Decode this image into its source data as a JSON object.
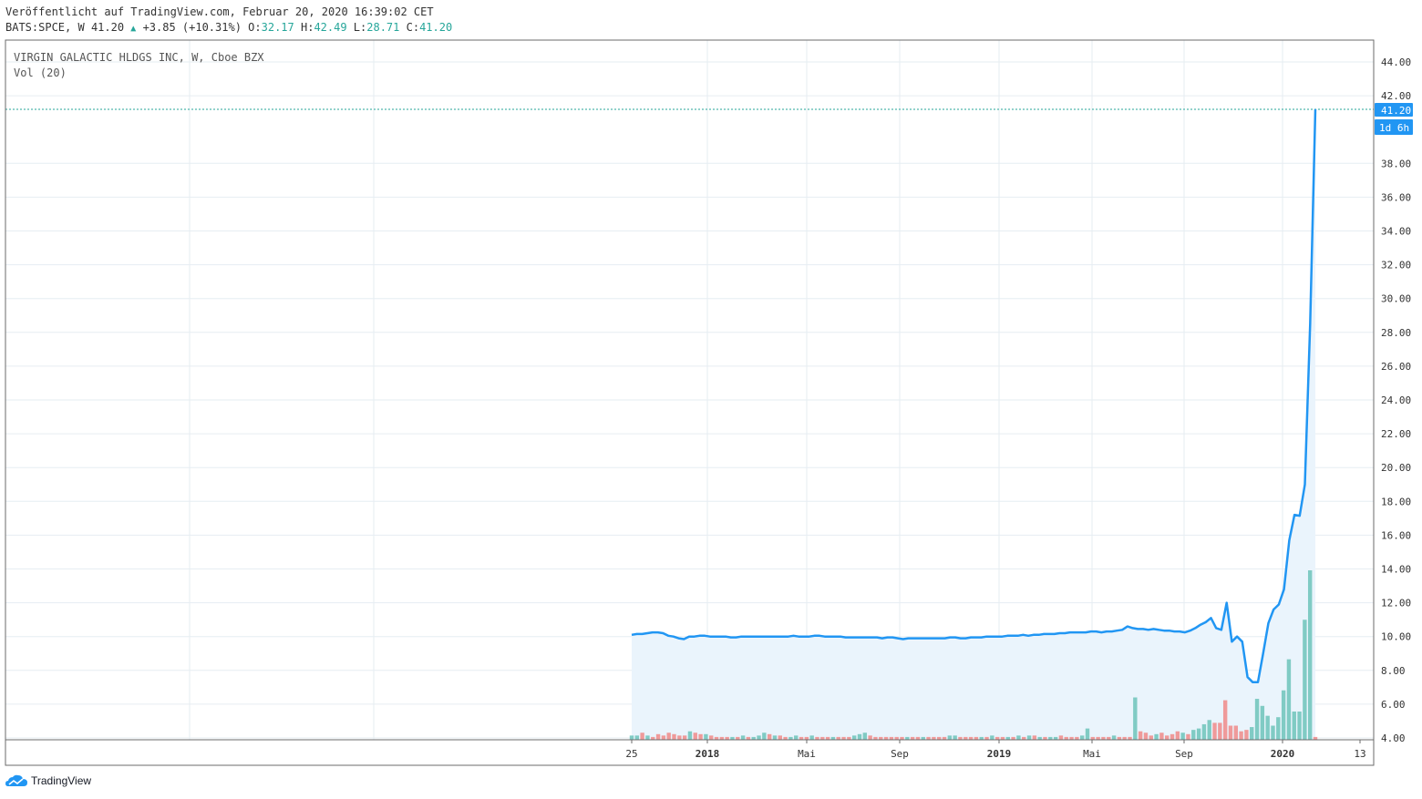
{
  "header": {
    "published": "Veröffentlicht auf TradingView.com, Februar 20, 2020 16:39:02 CET",
    "symbol": "BATS:SPCE, W",
    "last": "41.20",
    "change": "+3.85 (+10.31%)",
    "open_label": "O:",
    "open": "32.17",
    "high_label": "H:",
    "high": "42.49",
    "low_label": "L:",
    "low": "28.71",
    "close_label": "C:",
    "close": "41.20"
  },
  "legend": {
    "title": "VIRGIN GALACTIC HLDGS INC, W, Cboe BZX",
    "volume": "Vol (20)"
  },
  "price_badge": "41.20",
  "countdown_badge": "1d 6h",
  "brand": "TradingView",
  "colors": {
    "line": "#2196f3",
    "area": "#eaf4fc",
    "vol_up": "#80cbc4",
    "vol_down": "#ef9a9a",
    "grid": "#e6edf2",
    "price_line": "#26a69a"
  },
  "chart_data": {
    "type": "line",
    "ylim": [
      4,
      45
    ],
    "y_ticks": [
      "44.00",
      "42.00",
      "38.00",
      "36.00",
      "34.00",
      "32.00",
      "30.00",
      "28.00",
      "26.00",
      "24.00",
      "22.00",
      "20.00",
      "18.00",
      "16.00",
      "14.00",
      "12.00",
      "10.00",
      "8.00",
      "6.00",
      "4.00"
    ],
    "x_ticks": [
      "25",
      "2018",
      "Mai",
      "Sep",
      "2019",
      "Mai",
      "Sep",
      "2020",
      "13"
    ],
    "series": [
      {
        "values": [
          10.1,
          10.15,
          10.15,
          10.2,
          10.25,
          10.25,
          10.2,
          10.05,
          10.0,
          9.9,
          9.85,
          10.0,
          10.0,
          10.05,
          10.05,
          10.0,
          10.0,
          10.0,
          10.0,
          9.95,
          9.95,
          10.0,
          10.0,
          10.0,
          10.0,
          10.0,
          10.0,
          10.0,
          10.0,
          10.0,
          10.0,
          10.05,
          10.0,
          10.0,
          10.0,
          10.05,
          10.05,
          10.0,
          10.0,
          10.0,
          10.0,
          9.95,
          9.95,
          9.95,
          9.95,
          9.95,
          9.95,
          9.95,
          9.9,
          9.95,
          9.95,
          9.9,
          9.85,
          9.9,
          9.9,
          9.9,
          9.9,
          9.9,
          9.9,
          9.9,
          9.9,
          9.95,
          9.95,
          9.9,
          9.9,
          9.95,
          9.95,
          9.95,
          10.0,
          10.0,
          10.0,
          10.0,
          10.05,
          10.05,
          10.05,
          10.1,
          10.05,
          10.1,
          10.1,
          10.15,
          10.15,
          10.15,
          10.2,
          10.2,
          10.25,
          10.25,
          10.25,
          10.25,
          10.3,
          10.3,
          10.25,
          10.3,
          10.3,
          10.35,
          10.4,
          10.6,
          10.5,
          10.45,
          10.45,
          10.4,
          10.45,
          10.4,
          10.35,
          10.35,
          10.3,
          10.3,
          10.25,
          10.35,
          10.5,
          10.7,
          10.85,
          11.1,
          10.5,
          10.4,
          12.0,
          9.7,
          10.0,
          9.7,
          7.6,
          7.3,
          7.3,
          9.0,
          10.8,
          11.6,
          11.9,
          12.8,
          15.7,
          17.2,
          17.15,
          19.0,
          28.5,
          41.2
        ]
      }
    ],
    "volume": [
      {
        "v": 0.3,
        "up": true
      },
      {
        "v": 0.3,
        "up": true
      },
      {
        "v": 0.5,
        "up": false
      },
      {
        "v": 0.3,
        "up": true
      },
      {
        "v": 0.2,
        "up": false
      },
      {
        "v": 0.4,
        "up": false
      },
      {
        "v": 0.3,
        "up": false
      },
      {
        "v": 0.5,
        "up": false
      },
      {
        "v": 0.4,
        "up": false
      },
      {
        "v": 0.3,
        "up": false
      },
      {
        "v": 0.3,
        "up": false
      },
      {
        "v": 0.6,
        "up": true
      },
      {
        "v": 0.5,
        "up": false
      },
      {
        "v": 0.4,
        "up": false
      },
      {
        "v": 0.4,
        "up": true
      },
      {
        "v": 0.3,
        "up": false
      },
      {
        "v": 0.2,
        "up": false
      },
      {
        "v": 0.2,
        "up": false
      },
      {
        "v": 0.2,
        "up": false
      },
      {
        "v": 0.2,
        "up": true
      },
      {
        "v": 0.2,
        "up": false
      },
      {
        "v": 0.3,
        "up": true
      },
      {
        "v": 0.2,
        "up": false
      },
      {
        "v": 0.2,
        "up": true
      },
      {
        "v": 0.3,
        "up": true
      },
      {
        "v": 0.5,
        "up": true
      },
      {
        "v": 0.4,
        "up": false
      },
      {
        "v": 0.3,
        "up": true
      },
      {
        "v": 0.3,
        "up": false
      },
      {
        "v": 0.2,
        "up": false
      },
      {
        "v": 0.2,
        "up": true
      },
      {
        "v": 0.3,
        "up": true
      },
      {
        "v": 0.2,
        "up": false
      },
      {
        "v": 0.2,
        "up": false
      },
      {
        "v": 0.3,
        "up": true
      },
      {
        "v": 0.2,
        "up": false
      },
      {
        "v": 0.2,
        "up": false
      },
      {
        "v": 0.2,
        "up": false
      },
      {
        "v": 0.2,
        "up": true
      },
      {
        "v": 0.2,
        "up": false
      },
      {
        "v": 0.2,
        "up": false
      },
      {
        "v": 0.2,
        "up": false
      },
      {
        "v": 0.3,
        "up": true
      },
      {
        "v": 0.4,
        "up": true
      },
      {
        "v": 0.5,
        "up": true
      },
      {
        "v": 0.3,
        "up": false
      },
      {
        "v": 0.2,
        "up": false
      },
      {
        "v": 0.2,
        "up": false
      },
      {
        "v": 0.2,
        "up": false
      },
      {
        "v": 0.2,
        "up": false
      },
      {
        "v": 0.2,
        "up": false
      },
      {
        "v": 0.2,
        "up": false
      },
      {
        "v": 0.2,
        "up": true
      },
      {
        "v": 0.2,
        "up": false
      },
      {
        "v": 0.2,
        "up": false
      },
      {
        "v": 0.2,
        "up": true
      },
      {
        "v": 0.2,
        "up": false
      },
      {
        "v": 0.2,
        "up": false
      },
      {
        "v": 0.2,
        "up": false
      },
      {
        "v": 0.2,
        "up": false
      },
      {
        "v": 0.3,
        "up": true
      },
      {
        "v": 0.3,
        "up": true
      },
      {
        "v": 0.2,
        "up": false
      },
      {
        "v": 0.2,
        "up": false
      },
      {
        "v": 0.2,
        "up": false
      },
      {
        "v": 0.2,
        "up": false
      },
      {
        "v": 0.2,
        "up": true
      },
      {
        "v": 0.2,
        "up": false
      },
      {
        "v": 0.3,
        "up": true
      },
      {
        "v": 0.2,
        "up": false
      },
      {
        "v": 0.2,
        "up": false
      },
      {
        "v": 0.2,
        "up": true
      },
      {
        "v": 0.2,
        "up": false
      },
      {
        "v": 0.3,
        "up": true
      },
      {
        "v": 0.2,
        "up": false
      },
      {
        "v": 0.3,
        "up": true
      },
      {
        "v": 0.3,
        "up": false
      },
      {
        "v": 0.2,
        "up": true
      },
      {
        "v": 0.2,
        "up": false
      },
      {
        "v": 0.2,
        "up": true
      },
      {
        "v": 0.2,
        "up": true
      },
      {
        "v": 0.3,
        "up": false
      },
      {
        "v": 0.2,
        "up": false
      },
      {
        "v": 0.2,
        "up": false
      },
      {
        "v": 0.2,
        "up": false
      },
      {
        "v": 0.3,
        "up": true
      },
      {
        "v": 0.8,
        "up": true
      },
      {
        "v": 0.2,
        "up": false
      },
      {
        "v": 0.2,
        "up": false
      },
      {
        "v": 0.2,
        "up": false
      },
      {
        "v": 0.2,
        "up": false
      },
      {
        "v": 0.3,
        "up": true
      },
      {
        "v": 0.2,
        "up": false
      },
      {
        "v": 0.2,
        "up": false
      },
      {
        "v": 0.2,
        "up": false
      },
      {
        "v": 3.0,
        "up": true
      },
      {
        "v": 0.6,
        "up": false
      },
      {
        "v": 0.5,
        "up": false
      },
      {
        "v": 0.3,
        "up": false
      },
      {
        "v": 0.4,
        "up": true
      },
      {
        "v": 0.5,
        "up": false
      },
      {
        "v": 0.3,
        "up": false
      },
      {
        "v": 0.4,
        "up": false
      },
      {
        "v": 0.6,
        "up": false
      },
      {
        "v": 0.5,
        "up": true
      },
      {
        "v": 0.4,
        "up": false
      },
      {
        "v": 0.7,
        "up": true
      },
      {
        "v": 0.8,
        "up": true
      },
      {
        "v": 1.1,
        "up": true
      },
      {
        "v": 1.4,
        "up": true
      },
      {
        "v": 1.2,
        "up": false
      },
      {
        "v": 1.2,
        "up": false
      },
      {
        "v": 2.8,
        "up": false
      },
      {
        "v": 1.0,
        "up": false
      },
      {
        "v": 1.0,
        "up": false
      },
      {
        "v": 0.6,
        "up": false
      },
      {
        "v": 0.7,
        "up": false
      },
      {
        "v": 0.9,
        "up": true
      },
      {
        "v": 2.9,
        "up": true
      },
      {
        "v": 2.4,
        "up": true
      },
      {
        "v": 1.7,
        "up": true
      },
      {
        "v": 1.0,
        "up": true
      },
      {
        "v": 1.6,
        "up": true
      },
      {
        "v": 3.5,
        "up": true
      },
      {
        "v": 5.7,
        "up": true
      },
      {
        "v": 2.0,
        "up": true
      },
      {
        "v": 2.0,
        "up": true
      },
      {
        "v": 8.5,
        "up": true
      },
      {
        "v": 12.0,
        "up": true
      },
      {
        "v": 0.2,
        "up": false
      }
    ]
  }
}
